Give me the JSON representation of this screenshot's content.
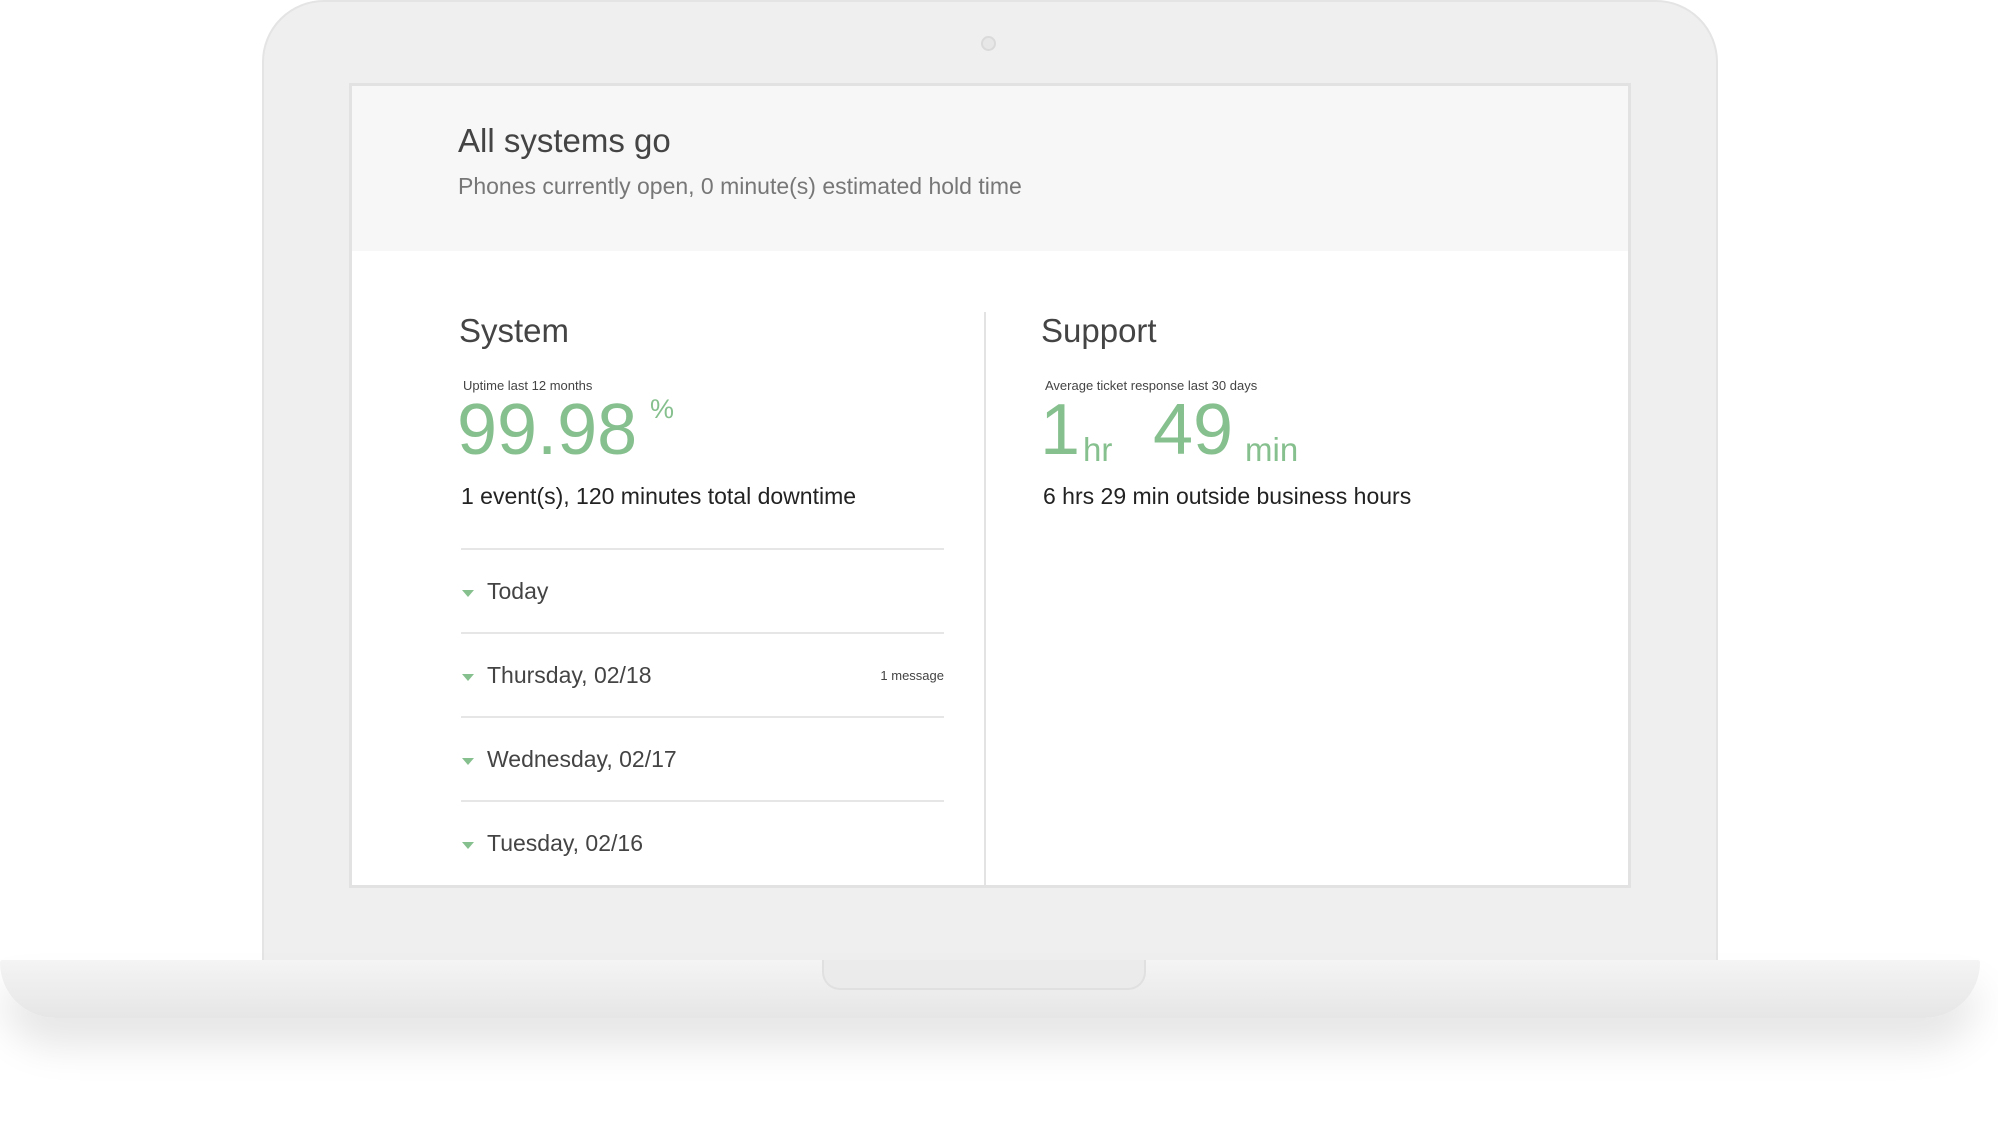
{
  "status": {
    "title": "All systems go",
    "subtitle": "Phones currently open, 0 minute(s) estimated hold time"
  },
  "system": {
    "title": "System",
    "metric_label": "Uptime last 12 months",
    "uptime_value": "99.98",
    "uptime_unit": "%",
    "detail": "1 event(s), 120 minutes total downtime",
    "days": [
      {
        "label": "Today",
        "count": ""
      },
      {
        "label": "Thursday, 02/18",
        "count": "1 message"
      },
      {
        "label": "Wednesday, 02/17",
        "count": ""
      },
      {
        "label": "Tuesday, 02/16",
        "count": ""
      }
    ]
  },
  "support": {
    "title": "Support",
    "metric_label": "Average ticket response last 30 days",
    "hours_value": "1",
    "hours_unit": "hr",
    "minutes_value": "49",
    "minutes_unit": "min",
    "detail": "6 hrs 29 min outside business hours"
  },
  "colors": {
    "accent": "#86c08e",
    "header_bg": "#f7f7f7",
    "device": "#efefef"
  },
  "icons": {
    "day_toggle": "caret-down-icon",
    "camera": "camera-icon"
  }
}
